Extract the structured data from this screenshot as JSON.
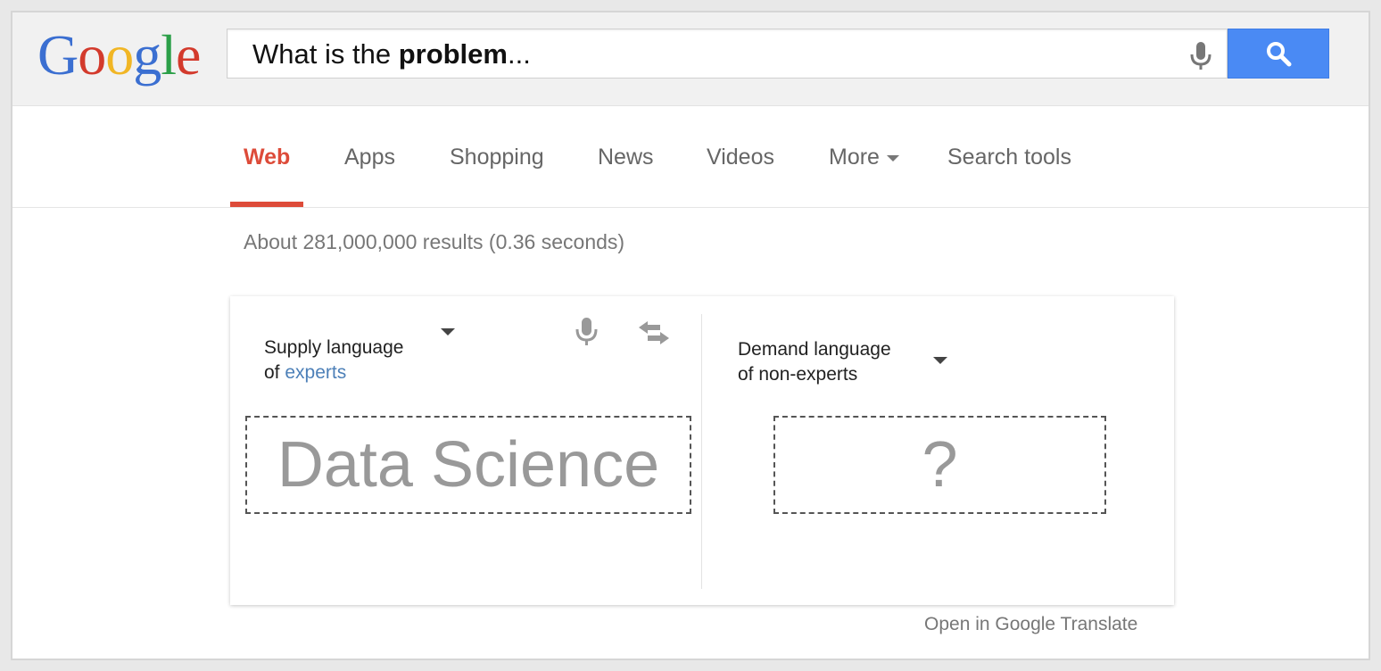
{
  "logo": {
    "letters": [
      "G",
      "o",
      "o",
      "g",
      "l",
      "e"
    ],
    "colors": [
      "#3b6fd1",
      "#d33a2c",
      "#f1b625",
      "#3b6fd1",
      "#2b9f48",
      "#d33a2c"
    ]
  },
  "search": {
    "query_prefix": "What is the ",
    "query_bold": "problem",
    "query_suffix": "...",
    "mic_icon": "mic-icon",
    "button_icon": "search-icon",
    "button_color": "#4a8af4"
  },
  "tabs": [
    {
      "label": "Web",
      "active": true
    },
    {
      "label": "Apps"
    },
    {
      "label": "Shopping"
    },
    {
      "label": "News"
    },
    {
      "label": "Videos"
    },
    {
      "label": "More"
    },
    {
      "label": "Search tools"
    }
  ],
  "accent": "#dd4b39",
  "results_stats": "About 281,000,000 results (0.36 seconds)",
  "translate": {
    "source": {
      "label_line1": "Supply language",
      "label_line2_prefix": "of ",
      "label_line2_link": "experts",
      "text": "Data Science"
    },
    "target": {
      "label_line1": "Demand language",
      "label_line2": "of non-experts",
      "text": "?"
    },
    "icons": [
      "mic-icon",
      "swap-arrows-icon",
      "chevron-down-icon"
    ],
    "open_link": "Open in Google Translate"
  }
}
